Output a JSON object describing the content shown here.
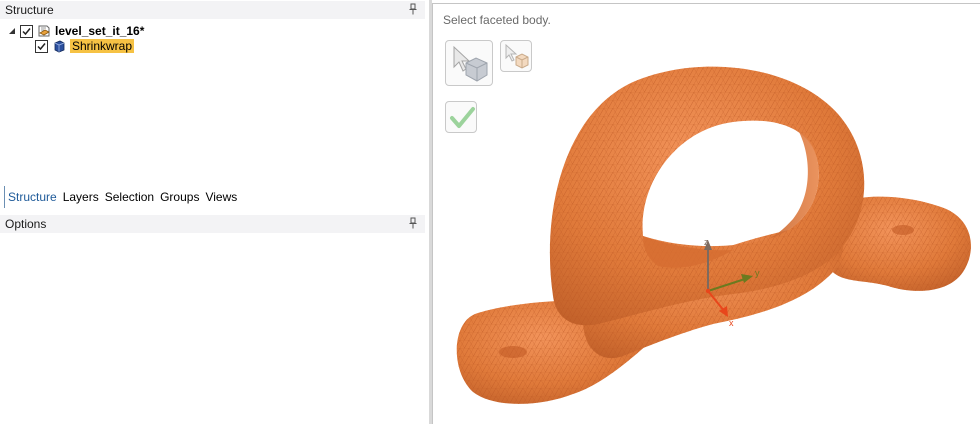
{
  "structure_panel": {
    "title": "Structure",
    "tree": {
      "root": {
        "label": "level_set_it_16*",
        "checked": true,
        "expanded": true,
        "icon": "part-icon"
      },
      "children": [
        {
          "label": "Shrinkwrap",
          "checked": true,
          "selected": true,
          "icon": "body-icon"
        }
      ]
    }
  },
  "tabs": [
    {
      "label": "Structure",
      "active": true
    },
    {
      "label": "Layers",
      "active": false
    },
    {
      "label": "Selection",
      "active": false
    },
    {
      "label": "Groups",
      "active": false
    },
    {
      "label": "Views",
      "active": false
    }
  ],
  "options_panel": {
    "title": "Options"
  },
  "viewport": {
    "prompt": "Select faceted body.",
    "tools": [
      {
        "icon": "select-body-icon",
        "active": true
      },
      {
        "icon": "select-small-body-icon",
        "active": false
      },
      {
        "icon": "checkmark-complete-icon",
        "active": false
      }
    ],
    "triad_axes": [
      "z",
      "y",
      "x"
    ],
    "model_color": "#e07a3a"
  },
  "colors": {
    "selection_highlight": "#f6c244",
    "active_tab_text": "#1e5a99",
    "panel_header_bg": "#f3f3f5"
  }
}
